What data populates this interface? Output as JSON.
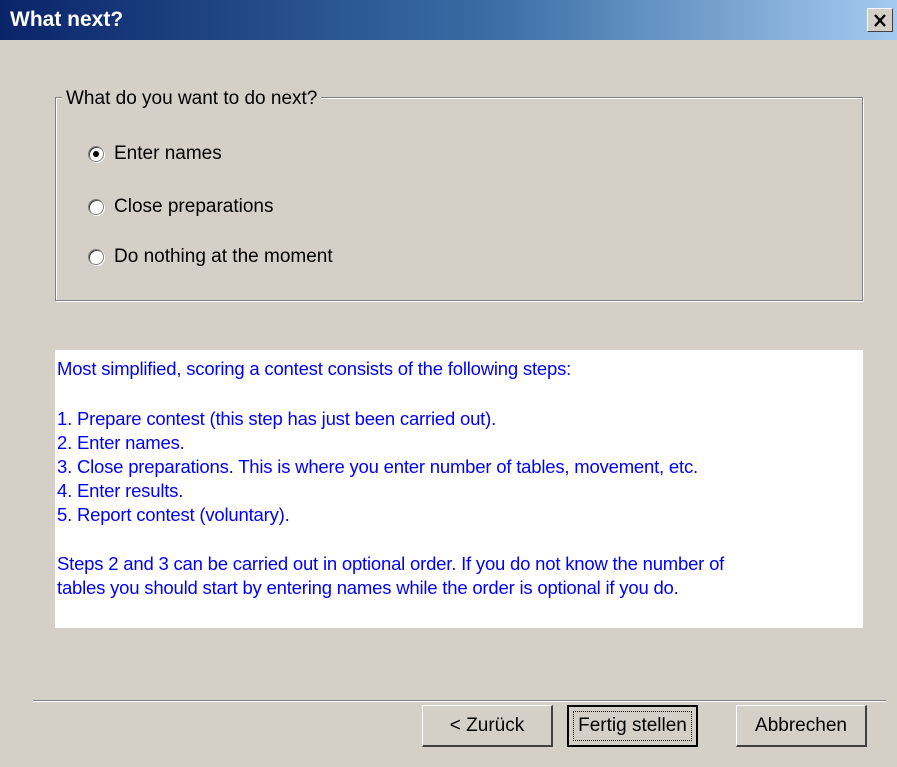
{
  "window": {
    "title": "What next?",
    "close_glyph": "X"
  },
  "options": {
    "legend": "What do you want to do next?",
    "items": [
      {
        "label": "Enter names",
        "checked": true
      },
      {
        "label": "Close preparations",
        "checked": false
      },
      {
        "label": "Do nothing at the moment",
        "checked": false
      }
    ]
  },
  "info": {
    "lines": [
      "Most simplified, scoring a contest consists of the following steps:",
      "1. Prepare contest (this step has just been carried out).",
      "2. Enter names.",
      "3. Close preparations. This is where you enter number of tables, movement, etc.",
      "4. Enter results.",
      "5. Report contest (voluntary).",
      "Steps 2 and 3 can be carried out in optional order. If you do not know the number of",
      "tables you should start by entering names while the order is optional if you do."
    ],
    "text_color": "#0000ff"
  },
  "buttons": {
    "back": "< Zurück",
    "finish": "Fertig stellen",
    "cancel": "Abbrechen"
  }
}
